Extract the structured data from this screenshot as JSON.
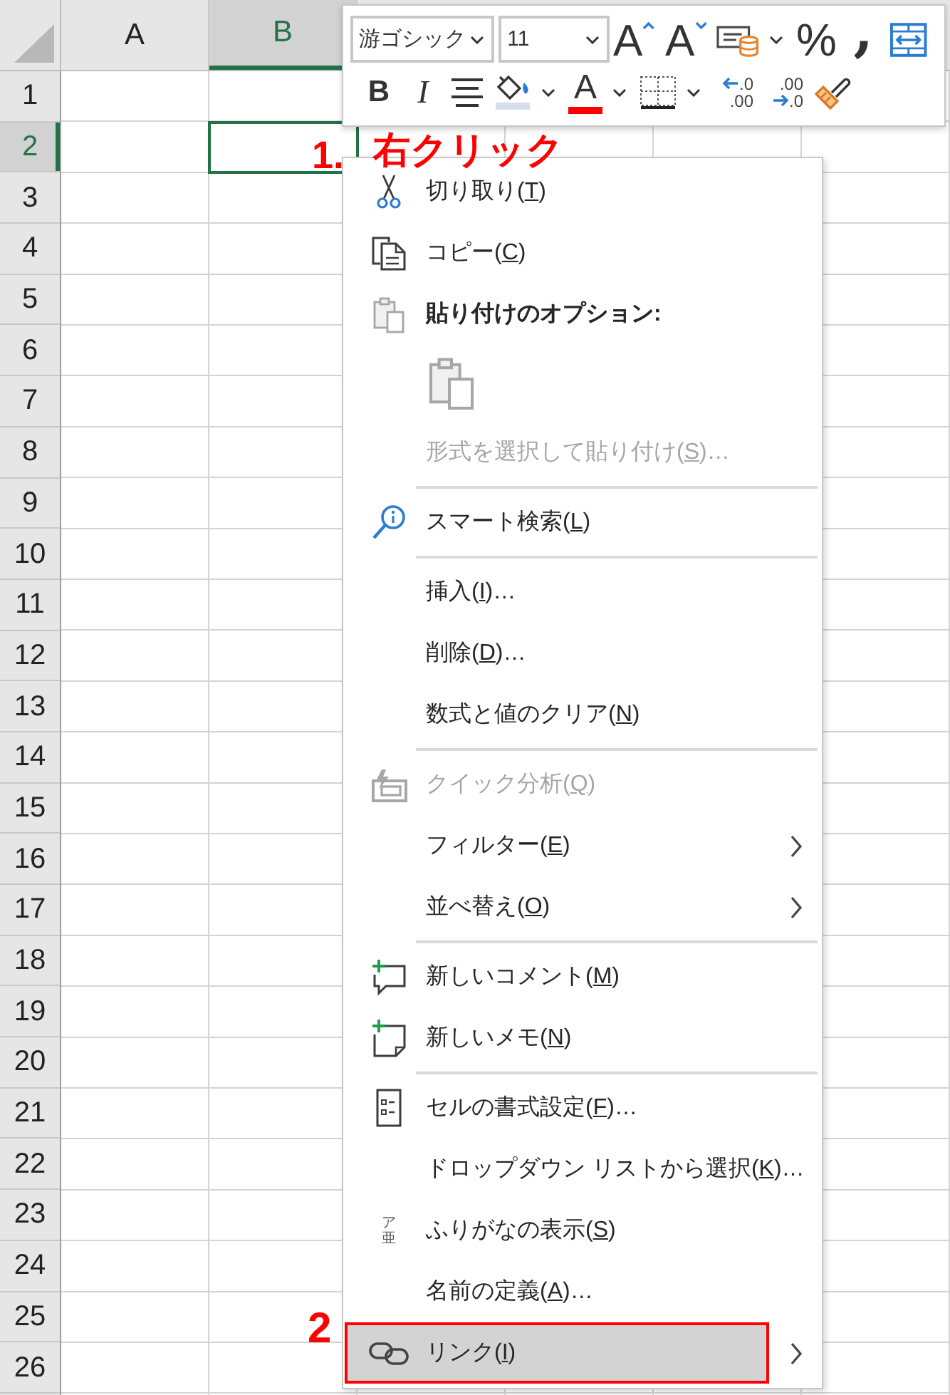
{
  "sheet": {
    "columns": [
      {
        "label": "A",
        "selected": false
      },
      {
        "label": "B",
        "selected": true
      }
    ],
    "rows": [
      {
        "label": "1",
        "selected": false
      },
      {
        "label": "2",
        "selected": true
      },
      {
        "label": "3",
        "selected": false
      },
      {
        "label": "4",
        "selected": false
      },
      {
        "label": "5",
        "selected": false
      },
      {
        "label": "6",
        "selected": false
      },
      {
        "label": "7",
        "selected": false
      },
      {
        "label": "8",
        "selected": false
      },
      {
        "label": "9",
        "selected": false
      },
      {
        "label": "10",
        "selected": false
      },
      {
        "label": "11",
        "selected": false
      },
      {
        "label": "12",
        "selected": false
      },
      {
        "label": "13",
        "selected": false
      },
      {
        "label": "14",
        "selected": false
      },
      {
        "label": "15",
        "selected": false
      },
      {
        "label": "16",
        "selected": false
      },
      {
        "label": "17",
        "selected": false
      },
      {
        "label": "18",
        "selected": false
      },
      {
        "label": "19",
        "selected": false
      },
      {
        "label": "20",
        "selected": false
      },
      {
        "label": "21",
        "selected": false
      },
      {
        "label": "22",
        "selected": false
      },
      {
        "label": "23",
        "selected": false
      },
      {
        "label": "24",
        "selected": false
      },
      {
        "label": "25",
        "selected": false
      },
      {
        "label": "26",
        "selected": false
      }
    ]
  },
  "mini_toolbar": {
    "font_name": "游ゴシック",
    "font_size": "11",
    "row_1": [
      {
        "kind": "grow-font",
        "label": "A",
        "has_menu": false
      },
      {
        "kind": "shrink-font",
        "label": "A",
        "has_menu": false
      },
      {
        "kind": "cell-styles",
        "has_menu": true
      },
      {
        "kind": "percent",
        "label": "%",
        "has_menu": false
      },
      {
        "kind": "comma",
        "label": ",",
        "has_menu": false
      },
      {
        "kind": "merge",
        "has_menu": false
      }
    ],
    "row_2": [
      {
        "kind": "bold",
        "label": "B",
        "has_menu": false
      },
      {
        "kind": "italic",
        "label": "I",
        "has_menu": false
      },
      {
        "kind": "align-center",
        "has_menu": false
      },
      {
        "kind": "fill-color",
        "color": "#d6ddf1",
        "has_menu": true
      },
      {
        "kind": "font-color",
        "label": "A",
        "color": "#ff0000",
        "has_menu": true
      },
      {
        "kind": "borders",
        "has_menu": true
      },
      {
        "kind": "increase-decimal",
        "top": ".0",
        "bottom": ".00",
        "has_menu": false
      },
      {
        "kind": "decrease-decimal",
        "top": ".00",
        "bottom": ".0",
        "has_menu": false
      },
      {
        "kind": "format-painter",
        "has_menu": false
      }
    ]
  },
  "context_menu": {
    "items": [
      {
        "kind": "cut",
        "before": "切り取り(",
        "key": "T",
        "after": ")",
        "disabled": false,
        "submenu": false,
        "selected": false,
        "outlined": false
      },
      {
        "kind": "copy",
        "before": "コピー(",
        "key": "C",
        "after": ")",
        "disabled": false,
        "submenu": false,
        "selected": false,
        "outlined": false
      },
      {
        "kind": "paste-heading",
        "before": "貼り付けのオプション:"
      },
      {
        "kind": "paste-button",
        "disabled": true,
        "selected": false,
        "outlined": false
      },
      {
        "kind": "plain",
        "before": "形式を選択して貼り付け(",
        "key": "S",
        "after": ")…",
        "disabled": true,
        "submenu": false,
        "selected": false,
        "outlined": false
      },
      {
        "kind": "separator"
      },
      {
        "kind": "lookup",
        "before": "スマート検索(",
        "key": "L",
        "after": ")",
        "disabled": false,
        "submenu": false,
        "selected": false,
        "outlined": false
      },
      {
        "kind": "separator"
      },
      {
        "kind": "plain",
        "before": "挿入(",
        "key": "I",
        "after": ")…",
        "disabled": false,
        "submenu": false,
        "selected": false,
        "outlined": false
      },
      {
        "kind": "plain",
        "before": "削除(",
        "key": "D",
        "after": ")…",
        "disabled": false,
        "submenu": false,
        "selected": false,
        "outlined": false
      },
      {
        "kind": "plain",
        "before": "数式と値のクリア(",
        "key": "N",
        "after": ")",
        "disabled": false,
        "submenu": false,
        "selected": false,
        "outlined": false
      },
      {
        "kind": "separator"
      },
      {
        "kind": "analysis",
        "before": "クイック分析(",
        "key": "Q",
        "after": ")",
        "disabled": true,
        "submenu": false,
        "selected": false,
        "outlined": false
      },
      {
        "kind": "plain",
        "before": "フィルター(",
        "key": "E",
        "after": ")",
        "disabled": false,
        "submenu": true,
        "selected": false,
        "outlined": false
      },
      {
        "kind": "plain",
        "before": "並べ替え(",
        "key": "O",
        "after": ")",
        "disabled": false,
        "submenu": true,
        "selected": false,
        "outlined": false
      },
      {
        "kind": "separator"
      },
      {
        "kind": "comment",
        "before": "新しいコメント(",
        "key": "M",
        "after": ")",
        "disabled": false,
        "submenu": false,
        "selected": false,
        "outlined": false
      },
      {
        "kind": "note",
        "before": "新しいメモ(",
        "key": "N",
        "after": ")",
        "disabled": false,
        "submenu": false,
        "selected": false,
        "outlined": false
      },
      {
        "kind": "separator"
      },
      {
        "kind": "format",
        "before": "セルの書式設定(",
        "key": "F",
        "after": ")…",
        "disabled": false,
        "submenu": false,
        "selected": false,
        "outlined": false
      },
      {
        "kind": "plain",
        "before": "ドロップダウン リストから選択(",
        "key": "K",
        "after": ")…",
        "disabled": false,
        "submenu": false,
        "selected": false,
        "outlined": false
      },
      {
        "kind": "furigana",
        "glyph": "ア亜",
        "before": "ふりがなの表示(",
        "key": "S",
        "after": ")",
        "disabled": false,
        "submenu": false,
        "selected": false,
        "outlined": false
      },
      {
        "kind": "plain",
        "before": "名前の定義(",
        "key": "A",
        "after": ")…",
        "disabled": false,
        "submenu": false,
        "selected": false,
        "outlined": false
      },
      {
        "kind": "link",
        "before": "リンク(",
        "key": "I",
        "after": ")",
        "disabled": false,
        "submenu": true,
        "selected": true,
        "outlined": true
      }
    ]
  },
  "annotations": {
    "step_1": {
      "number": "1.",
      "caption": "右クリック"
    },
    "step_2": {
      "number": "2"
    }
  }
}
